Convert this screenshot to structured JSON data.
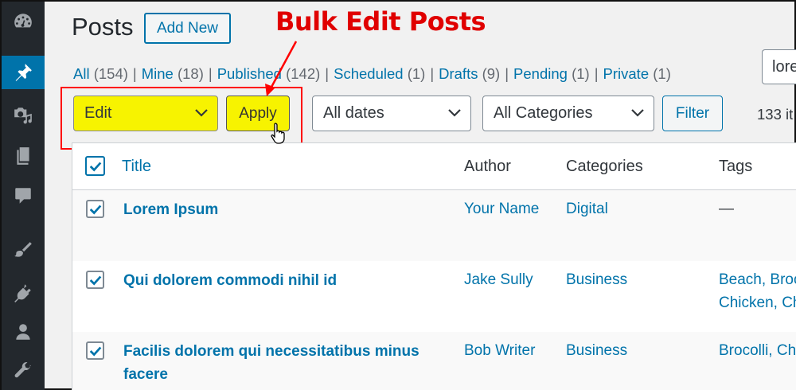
{
  "page": {
    "title": "Posts",
    "add_new_label": "Add New",
    "annotation": "Bulk Edit Posts",
    "search_value": "lore"
  },
  "filters": [
    {
      "label": "All",
      "count": "(154)"
    },
    {
      "label": "Mine",
      "count": "(18)"
    },
    {
      "label": "Published",
      "count": "(142)"
    },
    {
      "label": "Scheduled",
      "count": "(1)"
    },
    {
      "label": "Drafts",
      "count": "(9)"
    },
    {
      "label": "Pending",
      "count": "(1)"
    },
    {
      "label": "Private",
      "count": "(1)"
    }
  ],
  "bulk": {
    "action_selected": "Edit",
    "apply_label": "Apply",
    "dates_selected": "All dates",
    "categories_selected": "All Categories",
    "filter_label": "Filter",
    "items_count": "133 it"
  },
  "table": {
    "headers": {
      "title": "Title",
      "author": "Author",
      "categories": "Categories",
      "tags": "Tags"
    },
    "rows": [
      {
        "title_line1": "Lorem Ipsum",
        "title_line2": "",
        "author": "Your Name",
        "category": "Digital",
        "tags_line1": "—",
        "tags_line2": ""
      },
      {
        "title_line1": "Qui dolorem commodi nihil id",
        "title_line2": "",
        "author": "Jake Sully",
        "category": "Business",
        "tags_line1": "Beach, Broc",
        "tags_line2": "Chicken, Ch"
      },
      {
        "title_line1": "Facilis dolorem qui necessitatibus minus",
        "title_line2": "facere",
        "author": "Bob Writer",
        "category": "Business",
        "tags_line1": "Brocolli, Chi",
        "tags_line2": ""
      }
    ]
  },
  "colors": {
    "sidebar_bg": "#23282d",
    "active_menu": "#0073aa",
    "link": "#0073aa",
    "highlight_yellow": "#f7f300",
    "annotation_red": "#e00000"
  },
  "sidebar_icons": [
    "dashboard-icon",
    "pin-icon",
    "media-icon",
    "pages-icon",
    "comments-icon",
    "appearance-icon",
    "plugins-icon",
    "users-icon",
    "tools-icon"
  ]
}
